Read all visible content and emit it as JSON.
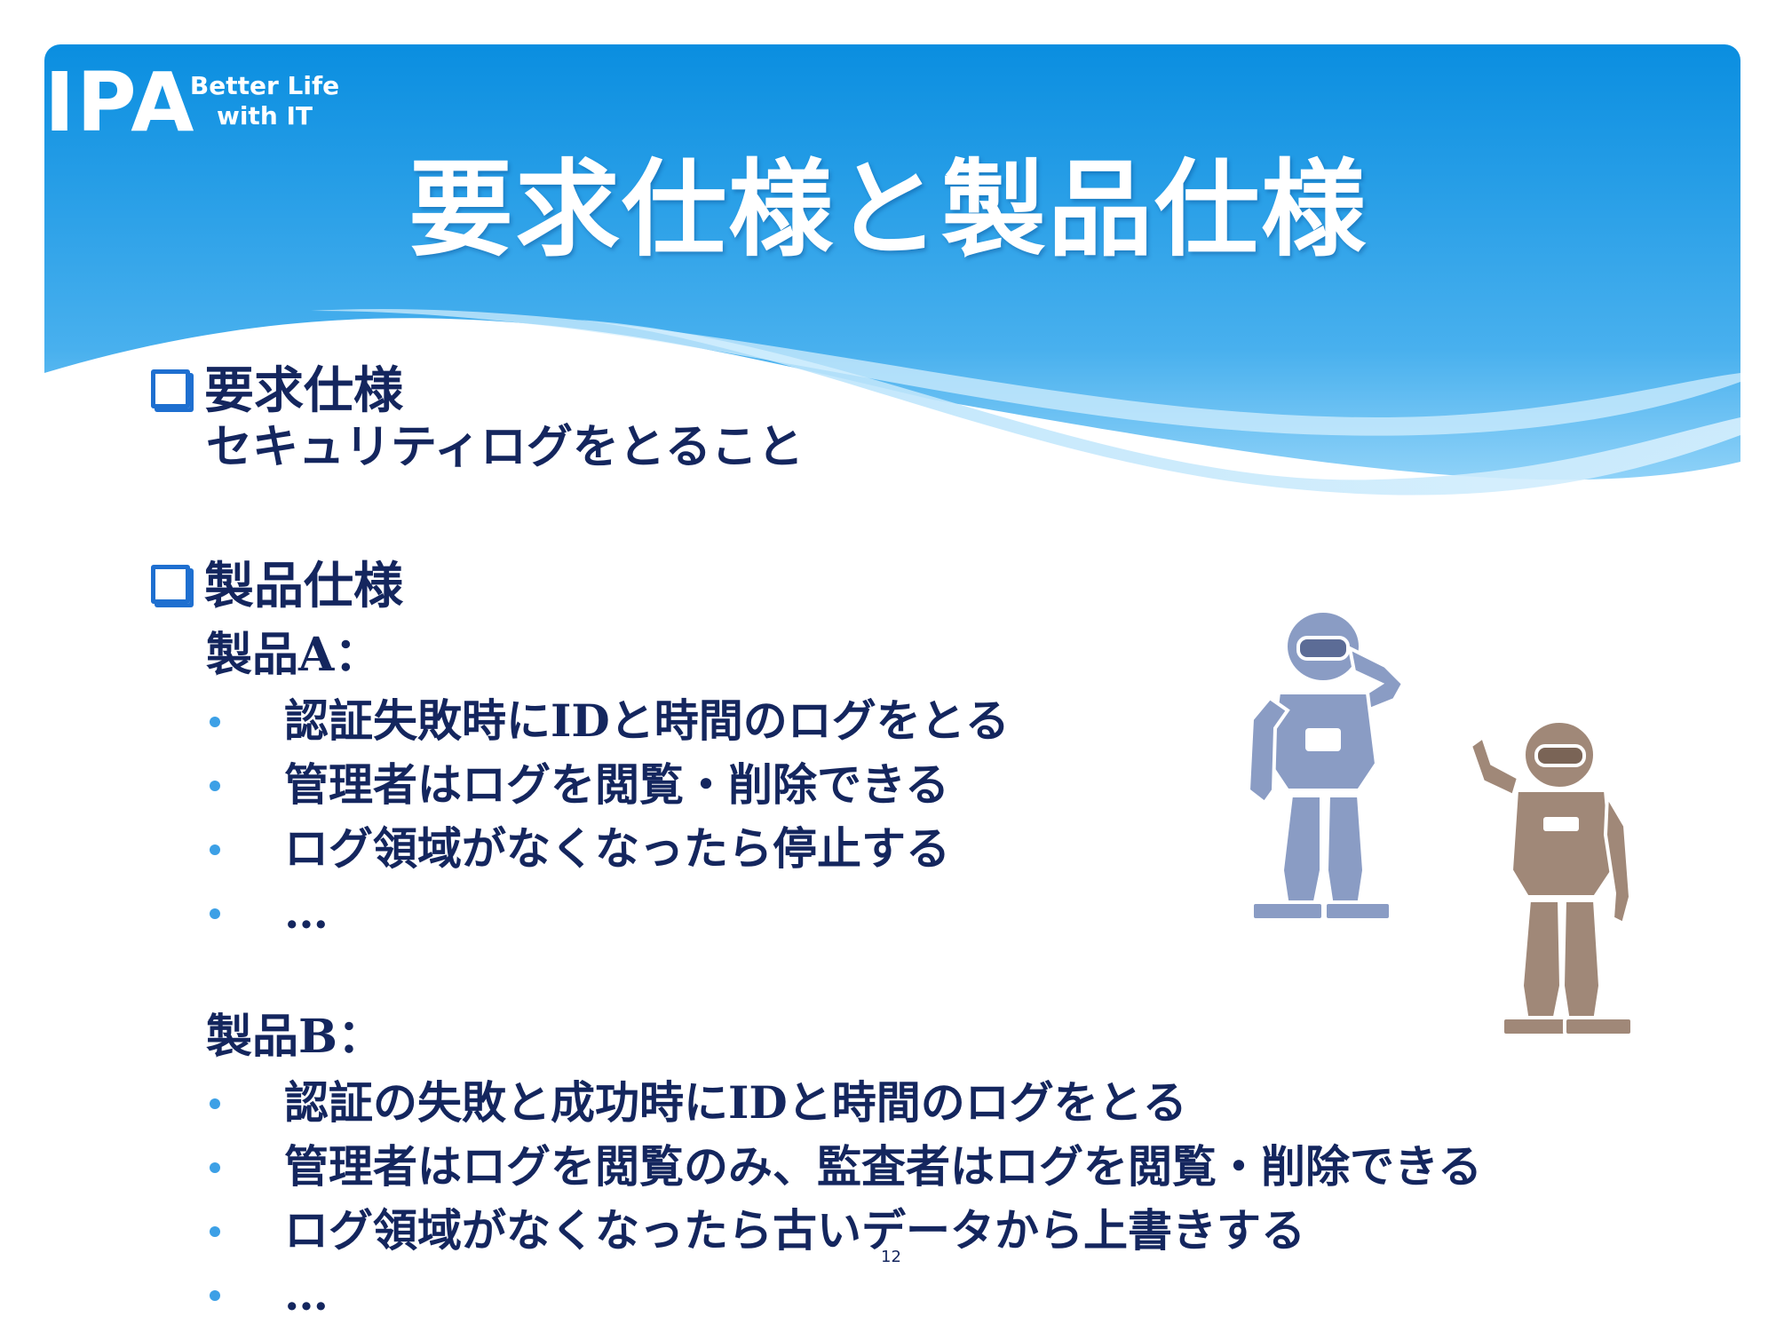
{
  "logo": {
    "mark": "IPA",
    "tagline_1": "Better Life",
    "tagline_2": "with IT"
  },
  "title": "要求仕様と製品仕様",
  "section_req": {
    "heading": "要求仕様",
    "text": "セキュリティログをとること"
  },
  "section_prod": {
    "heading": "製品仕様",
    "product_a": {
      "label": "製品A：",
      "bullets": [
        "認証失敗時にIDと時間のログをとる",
        "管理者はログを閲覧・削除できる",
        "ログ領域がなくなったら停止する",
        "…"
      ]
    },
    "product_b": {
      "label": "製品B：",
      "bullets": [
        "認証の失敗と成功時にIDと時間のログをとる",
        "管理者はログを閲覧のみ、監査者はログを閲覧・削除できる",
        "ログ領域がなくなったら古いデータから上書きする",
        "…"
      ]
    }
  },
  "page_number": "12",
  "colors": {
    "header_top": "#0a8ee0",
    "header_bottom": "#6cc0f2",
    "text": "#14265e",
    "bullet": "#3ca0e6",
    "robot_blue": "#8a9cc4",
    "robot_brown": "#a08878"
  }
}
